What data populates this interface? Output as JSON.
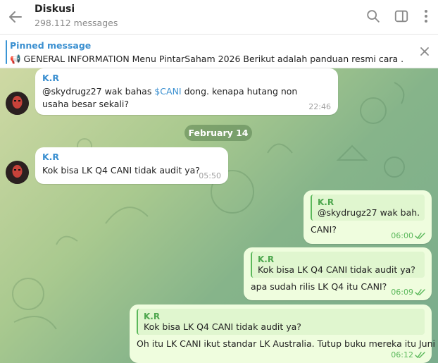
{
  "header": {
    "title": "Diskusi",
    "subtitle": "298.112 messages"
  },
  "pinned": {
    "label": "Pinned message",
    "text": "📢 GENERAL INFORMATION  Menu PintarSaham 2026 Berikut adalah panduan resmi cara ..."
  },
  "date_separator": "February 14",
  "messages": [
    {
      "sender": "K.R",
      "text_prefix": "@skydrugz27 wak bahas ",
      "hashtag": "$CANI",
      "text_suffix": " dong. kenapa hutang non usaha besar sekali?",
      "time": "22:46"
    },
    {
      "sender": "K.R",
      "text": "Kok bisa LK Q4 CANI tidak audit ya?",
      "time": "05:50"
    },
    {
      "reply_name": "K.R",
      "reply_text": "@skydrugz27 wak bah...",
      "text": "CANI?",
      "time": "06:00"
    },
    {
      "reply_name": "K.R",
      "reply_text": "Kok bisa LK Q4 CANI tidak audit ya?",
      "text": "apa sudah rilis LK Q4 itu CANI?",
      "time": "06:09"
    },
    {
      "reply_name": "K.R",
      "reply_text": "Kok bisa LK Q4 CANI tidak audit ya?",
      "text": "Oh itu LK CANI ikut standar LK Australia. Tutup buku mereka itu Juni",
      "time": "06:12"
    }
  ],
  "icons": [
    "back-arrow-icon",
    "search-icon",
    "sidebar-toggle-icon",
    "more-vertical-icon",
    "close-icon",
    "double-check-icon"
  ],
  "colors": {
    "accent": "#3a8fd0",
    "outgoing": "#effdde",
    "check": "#5bb85b"
  }
}
